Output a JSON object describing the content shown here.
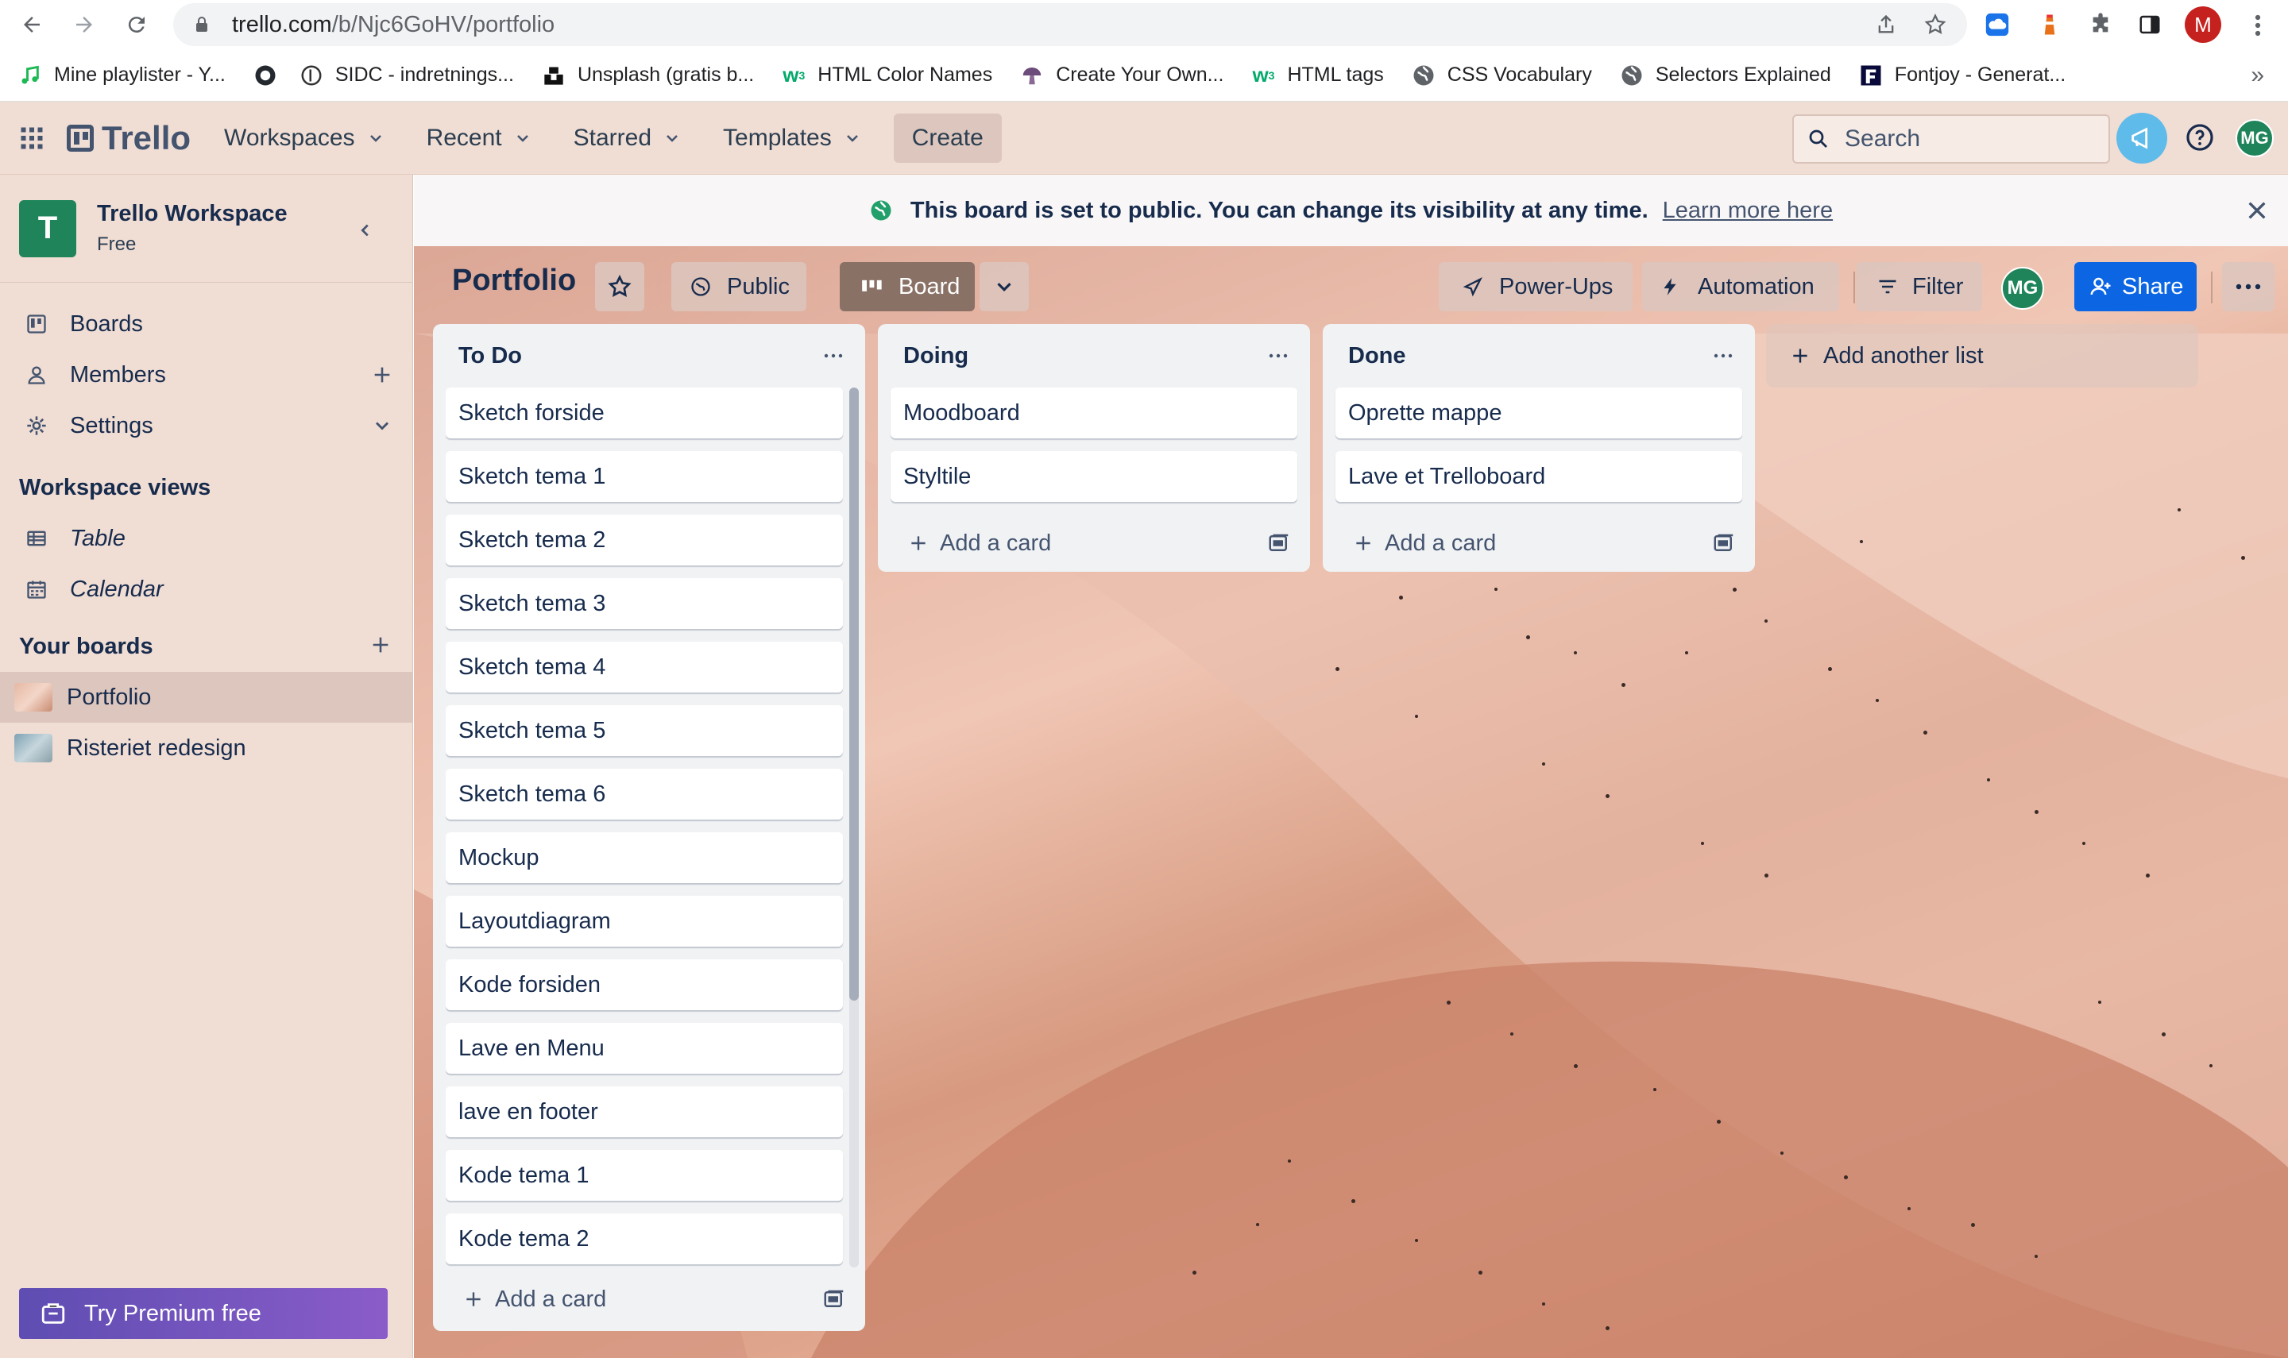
{
  "browser": {
    "url_host": "trello.com",
    "url_path": "/b/Njc6GoHV/portfolio",
    "profile_initial": "M"
  },
  "bookmarks": [
    {
      "label": "Mine playlister - Y...",
      "icon": "music-note-icon"
    },
    {
      "label": "",
      "icon": "github-icon"
    },
    {
      "label": "SIDC - indretnings...",
      "icon": "sidc-icon"
    },
    {
      "label": "Unsplash (gratis b...",
      "icon": "unsplash-icon"
    },
    {
      "label": "HTML Color Names",
      "icon": "w3schools-icon"
    },
    {
      "label": "Create Your Own...",
      "icon": "mushroom-icon"
    },
    {
      "label": "HTML tags",
      "icon": "w3schools-icon"
    },
    {
      "label": "CSS Vocabulary",
      "icon": "globe-icon"
    },
    {
      "label": "Selectors Explained",
      "icon": "globe-icon"
    },
    {
      "label": "Fontjoy - Generat...",
      "icon": "fontjoy-icon"
    }
  ],
  "header": {
    "logo": "Trello",
    "nav": [
      "Workspaces",
      "Recent",
      "Starred",
      "Templates"
    ],
    "create": "Create",
    "search_placeholder": "Search",
    "avatar_initials": "MG"
  },
  "sidebar": {
    "workspace_initial": "T",
    "workspace_name": "Trello Workspace",
    "workspace_plan": "Free",
    "items": [
      {
        "label": "Boards",
        "icon": "board-icon"
      },
      {
        "label": "Members",
        "icon": "person-icon"
      },
      {
        "label": "Settings",
        "icon": "gear-icon"
      }
    ],
    "views_heading": "Workspace views",
    "views": [
      {
        "label": "Table",
        "icon": "table-icon"
      },
      {
        "label": "Calendar",
        "icon": "calendar-icon"
      }
    ],
    "boards_heading": "Your boards",
    "boards": [
      {
        "label": "Portfolio",
        "active": true
      },
      {
        "label": "Risteriet redesign",
        "active": false
      }
    ],
    "premium": "Try Premium free"
  },
  "banner": {
    "message": "This board is set to public. You can change its visibility at any time.",
    "link": "Learn more here"
  },
  "board": {
    "title": "Portfolio",
    "visibility": "Public",
    "view": "Board",
    "powerups": "Power-Ups",
    "automation": "Automation",
    "filter": "Filter",
    "member_initials": "MG",
    "share": "Share"
  },
  "lists": [
    {
      "title": "To Do",
      "cards": [
        "Sketch forside",
        "Sketch tema 1",
        "Sketch tema 2",
        "Sketch tema 3",
        "Sketch tema 4",
        "Sketch tema 5",
        "Sketch tema 6",
        "Mockup",
        "Layoutdiagram",
        "Kode forsiden",
        "Lave en Menu",
        "lave en footer",
        "Kode tema 1",
        "Kode tema 2"
      ],
      "add_card": "Add a card"
    },
    {
      "title": "Doing",
      "cards": [
        "Moodboard",
        "Styltile"
      ],
      "add_card": "Add a card"
    },
    {
      "title": "Done",
      "cards": [
        "Oprette mappe",
        "Lave et Trelloboard"
      ],
      "add_card": "Add a card"
    }
  ],
  "add_list": "Add another list",
  "colors": {
    "header_bg": "#f0ddd4",
    "accent_blue": "#0c66e4",
    "workspace_green": "#1f845a",
    "premium_purple": "#5e4db2"
  }
}
